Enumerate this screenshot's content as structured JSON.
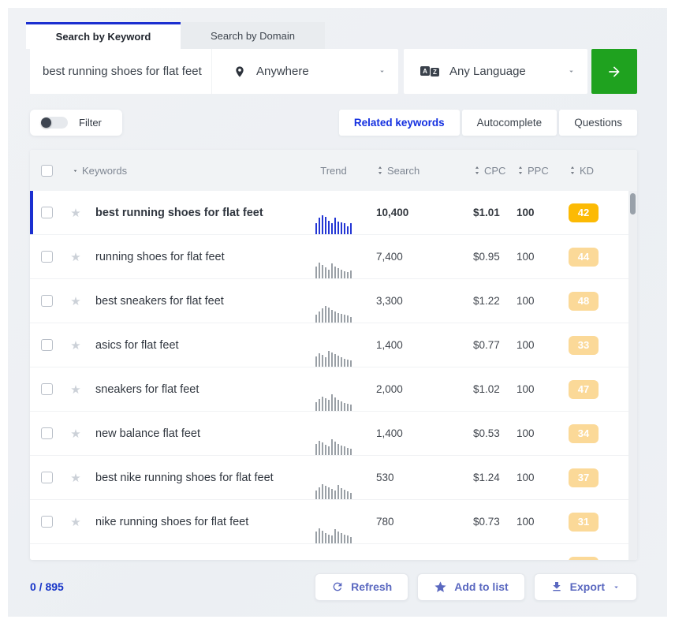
{
  "header_tabs": {
    "keyword": "Search by Keyword",
    "domain": "Search by Domain"
  },
  "search_bar": {
    "query": "best running shoes for flat feet",
    "location": "Anywhere",
    "language": "Any Language"
  },
  "toolbar": {
    "filter_label": "Filter",
    "view_tabs": [
      {
        "label": "Related keywords",
        "active": true
      },
      {
        "label": "Autocomplete",
        "active": false
      },
      {
        "label": "Questions",
        "active": false
      }
    ]
  },
  "table": {
    "headers": {
      "keywords": "Keywords",
      "trend": "Trend",
      "search": "Search",
      "cpc": "CPC",
      "ppc": "PPC",
      "kd": "KD"
    },
    "rows": [
      {
        "keyword": "best running shoes for flat feet",
        "search": "10,400",
        "cpc": "$1.01",
        "ppc": "100",
        "kd": "42",
        "active": true,
        "trend": [
          55,
          85,
          95,
          90,
          70,
          55,
          85,
          65,
          60,
          58,
          42,
          55
        ]
      },
      {
        "keyword": "running shoes for flat feet",
        "search": "7,400",
        "cpc": "$0.95",
        "ppc": "100",
        "kd": "44",
        "active": false,
        "trend": [
          60,
          82,
          70,
          56,
          46,
          76,
          62,
          52,
          44,
          38,
          34,
          42
        ]
      },
      {
        "keyword": "best sneakers for flat feet",
        "search": "3,300",
        "cpc": "$1.22",
        "ppc": "100",
        "kd": "48",
        "active": false,
        "trend": [
          42,
          56,
          72,
          84,
          76,
          66,
          58,
          50,
          44,
          40,
          36,
          30
        ]
      },
      {
        "keyword": "asics for flat feet",
        "search": "1,400",
        "cpc": "$0.77",
        "ppc": "100",
        "kd": "33",
        "active": false,
        "trend": [
          52,
          70,
          60,
          48,
          82,
          74,
          64,
          56,
          48,
          42,
          38,
          32
        ]
      },
      {
        "keyword": "sneakers for flat feet",
        "search": "2,000",
        "cpc": "$1.02",
        "ppc": "100",
        "kd": "47",
        "active": false,
        "trend": [
          46,
          62,
          74,
          66,
          56,
          86,
          70,
          56,
          48,
          42,
          38,
          34
        ]
      },
      {
        "keyword": "new balance flat feet",
        "search": "1,400",
        "cpc": "$0.53",
        "ppc": "100",
        "kd": "34",
        "active": false,
        "trend": [
          56,
          74,
          64,
          52,
          46,
          80,
          68,
          58,
          50,
          44,
          38,
          32
        ]
      },
      {
        "keyword": "best nike running shoes for flat feet",
        "search": "530",
        "cpc": "$1.24",
        "ppc": "100",
        "kd": "37",
        "active": false,
        "trend": [
          44,
          60,
          76,
          68,
          60,
          52,
          46,
          72,
          58,
          48,
          42,
          34
        ]
      },
      {
        "keyword": "nike running shoes for flat feet",
        "search": "780",
        "cpc": "$0.73",
        "ppc": "100",
        "kd": "31",
        "active": false,
        "trend": [
          62,
          78,
          66,
          54,
          46,
          40,
          74,
          62,
          52,
          46,
          40,
          32
        ]
      },
      {
        "keyword": "",
        "search": "",
        "cpc": "",
        "ppc": "",
        "kd": "",
        "active": false,
        "trend": []
      }
    ]
  },
  "footer": {
    "count": "0 / 895",
    "refresh": "Refresh",
    "add_to_list": "Add to list",
    "export": "Export"
  },
  "colors": {
    "accent_blue": "#1b2fd0",
    "active_link_blue": "#1430e0",
    "submit_green": "#1fa21f",
    "kd_badge_active": "#fcba04",
    "kd_badge_pale": "#fbd998",
    "trend_bar_active": "#2336d4",
    "trend_bar": "#9aa0a6",
    "panel_bg": "#eef0f3"
  }
}
